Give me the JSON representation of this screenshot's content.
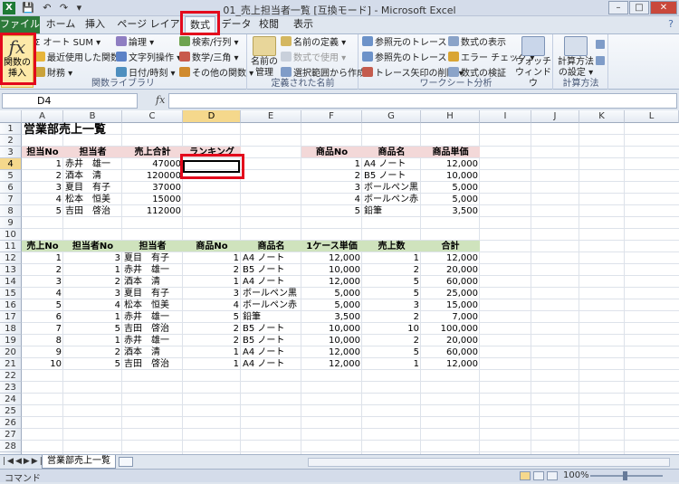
{
  "window": {
    "title": "01_売上担当者一覧 [互換モード] - Microsoft Excel",
    "app_icon": "X",
    "qat": "💾 ↶ ↷ ▾"
  },
  "tabs": {
    "file": "ファイル",
    "home": "ホーム",
    "insert": "挿入",
    "page_layout": "ページ レイアウト",
    "formulas": "数式",
    "data": "データ",
    "review": "校閲",
    "view": "表示"
  },
  "ribbon": {
    "insert_function": {
      "glyph": "fx",
      "label1": "関数の",
      "label2": "挿入"
    },
    "autosum": "Σ オート SUM ▾",
    "recent": "最近使用した関数 ▾",
    "financial": "財務 ▾",
    "logical": "論理 ▾",
    "text": "文字列操作 ▾",
    "datetime": "日付/時刻 ▾",
    "lookup": "検索/行列 ▾",
    "math": "数学/三角 ▾",
    "more": "その他の関数 ▾",
    "library_label": "関数ライブラリ",
    "name_manager1": "名前の",
    "name_manager2": "管理",
    "define_name": "名前の定義 ▾",
    "use_in_formula": "数式で使用 ▾",
    "create_from_sel": "選択範囲から作成",
    "names_label": "定義された名前",
    "trace_prec": "参照元のトレース",
    "trace_dep": "参照先のトレース",
    "remove_arrows": "トレース矢印の削除 ▾",
    "show_formulas": "数式の表示",
    "error_check": "エラー チェック ▾",
    "evaluate": "数式の検証",
    "watch1": "ウォッチ",
    "watch2": "ウィンドウ",
    "audit_label": "ワークシート分析",
    "calc_options1": "計算方法",
    "calc_options2": "の設定 ▾",
    "calc_label": "計算方法"
  },
  "formula_bar": {
    "name_box": "D4",
    "fx": "fx",
    "formula": ""
  },
  "columns": [
    "A",
    "B",
    "C",
    "D",
    "E",
    "F",
    "G",
    "H",
    "I",
    "J",
    "K",
    "L"
  ],
  "rows": [
    "1",
    "2",
    "3",
    "4",
    "5",
    "6",
    "7",
    "8",
    "9",
    "10",
    "11",
    "12",
    "13",
    "14",
    "15",
    "16",
    "17",
    "18",
    "19",
    "20",
    "21",
    "22",
    "23",
    "24",
    "25",
    "26",
    "27",
    "28",
    "29"
  ],
  "sheet": {
    "title": "営業部売上一覧",
    "staff_headers": [
      "担当No",
      "担当者",
      "売上合計",
      "ランキング"
    ],
    "staff": [
      [
        "1",
        "赤井　雄一",
        "47000"
      ],
      [
        "2",
        "酒本　清",
        "120000"
      ],
      [
        "3",
        "夏目　有子",
        "37000"
      ],
      [
        "4",
        "松本　恒美",
        "15000"
      ],
      [
        "5",
        "吉田　啓治",
        "112000"
      ]
    ],
    "product_headers": [
      "商品No",
      "商品名",
      "商品単価"
    ],
    "products": [
      [
        "1",
        "A4 ノート",
        "12,000"
      ],
      [
        "2",
        "B5 ノート",
        "10,000"
      ],
      [
        "3",
        "ボールペン黒",
        "5,000"
      ],
      [
        "4",
        "ボールペン赤",
        "5,000"
      ],
      [
        "5",
        "鉛筆",
        "3,500"
      ]
    ],
    "sales_headers": [
      "売上No",
      "担当者No",
      "担当者",
      "商品No",
      "商品名",
      "1ケース単価",
      "売上数",
      "合計"
    ],
    "sales": [
      [
        "1",
        "3",
        "夏目　有子",
        "1",
        "A4 ノート",
        "12,000",
        "1",
        "12,000"
      ],
      [
        "2",
        "1",
        "赤井　雄一",
        "2",
        "B5 ノート",
        "10,000",
        "2",
        "20,000"
      ],
      [
        "3",
        "2",
        "酒本　清",
        "1",
        "A4 ノート",
        "12,000",
        "5",
        "60,000"
      ],
      [
        "4",
        "3",
        "夏目　有子",
        "3",
        "ボールペン黒",
        "5,000",
        "5",
        "25,000"
      ],
      [
        "5",
        "4",
        "松本　恒美",
        "4",
        "ボールペン赤",
        "5,000",
        "3",
        "15,000"
      ],
      [
        "6",
        "1",
        "赤井　雄一",
        "5",
        "鉛筆",
        "3,500",
        "2",
        "7,000"
      ],
      [
        "7",
        "5",
        "吉田　啓治",
        "2",
        "B5 ノート",
        "10,000",
        "10",
        "100,000"
      ],
      [
        "8",
        "1",
        "赤井　雄一",
        "2",
        "B5 ノート",
        "10,000",
        "2",
        "20,000"
      ],
      [
        "9",
        "2",
        "酒本　清",
        "1",
        "A4 ノート",
        "12,000",
        "5",
        "60,000"
      ],
      [
        "10",
        "5",
        "吉田　啓治",
        "1",
        "A4 ノート",
        "12,000",
        "1",
        "12,000"
      ]
    ]
  },
  "sheet_tab": "営業部売上一覧",
  "status": {
    "mode": "コマンド",
    "zoom": "100%"
  },
  "colors": {
    "highlight": "#e3091c",
    "pink_header": "#f3d8d8",
    "green_header": "#cfe3bd",
    "file_tab": "#2d7a3a"
  }
}
